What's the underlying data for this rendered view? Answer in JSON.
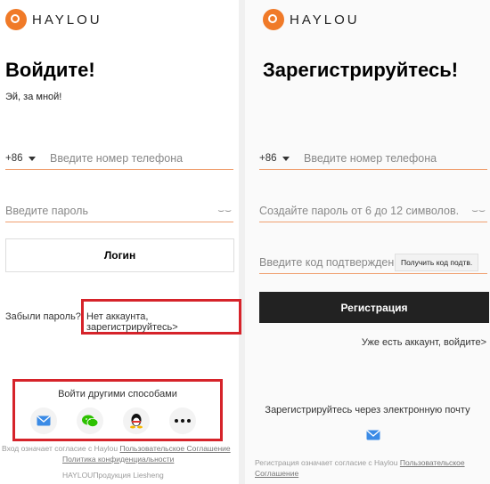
{
  "brand": "HAYLOU",
  "login": {
    "title": "Войдите!",
    "subtitle": "Эй, за мной!",
    "country_code": "+86",
    "phone_placeholder": "Введите номер телефона",
    "password_placeholder": "Введите пароль",
    "login_button": "Логин",
    "forgot_password": "Забыли пароль?",
    "register_link": "Нет аккаунта, зарегистрируйтесь>",
    "other_methods": "Войти другими способами",
    "agreement_prefix": "Вход означает согласие с Haylou",
    "user_agreement": "Пользовательское Соглашение",
    "privacy_policy": "Политика конфиденциальности",
    "footer": "HAYLOUПродукция Liesheng"
  },
  "register": {
    "title": "Зарегистрируйтесь!",
    "country_code": "+86",
    "phone_placeholder": "Введите номер телефона",
    "password_placeholder": "Создайте пароль от 6 до 12 символов.",
    "code_placeholder": "Введите код подтверждения",
    "get_code_button": "Получить код подтв.",
    "register_button": "Регистрация",
    "have_account": "Уже есть аккаунт, войдите>",
    "register_email": "Зарегистрируйтесь через электронную почту",
    "agreement_prefix": "Регистрация означает согласие с Haylou",
    "user_agreement": "Пользовательское Соглашение"
  },
  "colors": {
    "accent": "#f07a28",
    "highlight": "#d6232a",
    "dark_button": "#222222"
  },
  "icons": [
    "mail-icon",
    "wechat-icon",
    "qq-icon",
    "more-icon"
  ]
}
